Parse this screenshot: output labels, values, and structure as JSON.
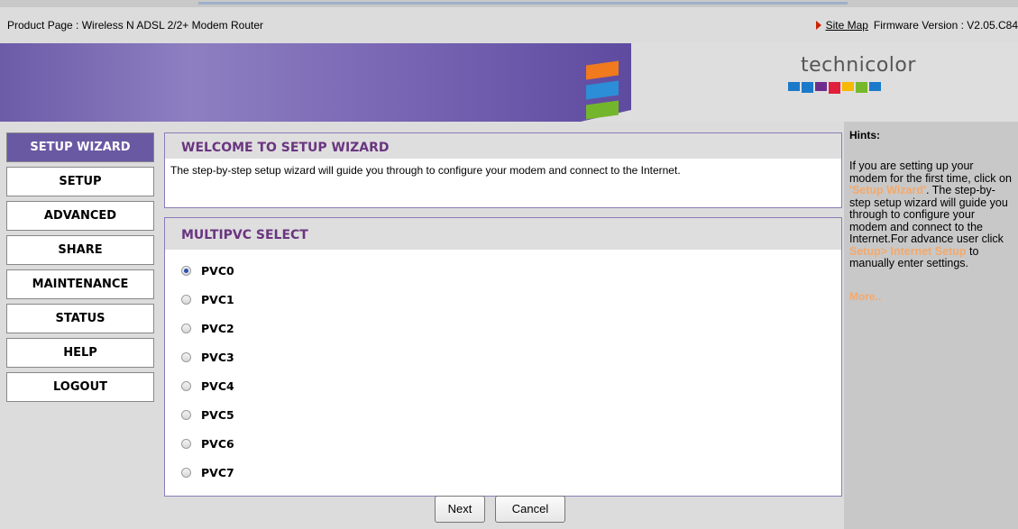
{
  "header": {
    "product_page": "Product Page : Wireless N ADSL 2/2+ Modem Router",
    "site_map": "Site Map",
    "firmware": "Firmware Version : V2.05.C84"
  },
  "banner": {
    "logo_text": "technicolor"
  },
  "sidebar": {
    "items": [
      {
        "label": "SETUP WIZARD",
        "active": true
      },
      {
        "label": "SETUP"
      },
      {
        "label": "ADVANCED"
      },
      {
        "label": "SHARE"
      },
      {
        "label": "MAINTENANCE"
      },
      {
        "label": "STATUS"
      },
      {
        "label": "HELP"
      },
      {
        "label": "LOGOUT"
      }
    ]
  },
  "welcome": {
    "title": "WELCOME TO SETUP WIZARD",
    "text": "The step-by-step setup wizard will guide you through to configure your modem and connect to the Internet."
  },
  "multipvc": {
    "title": "MULTIPVC SELECT",
    "options": [
      "PVC0",
      "PVC1",
      "PVC2",
      "PVC3",
      "PVC4",
      "PVC5",
      "PVC6",
      "PVC7"
    ],
    "selected": "PVC0"
  },
  "buttons": {
    "next": "Next",
    "cancel": "Cancel"
  },
  "hints": {
    "title": "Hints:",
    "part1": "If you are setting up your modem for the first time, click on ",
    "link1": "'Setup Wizard'",
    "part2": ". The step-by-step setup wizard will guide you through to configure your modem and connect to the Internet.For advance user click ",
    "link2": "Setup> Internet Setup",
    "part3": " to manually enter settings.",
    "more": "More.."
  },
  "colors": {
    "menu_active": "#6959a3",
    "title_text": "#6a3580",
    "hint_link": "#f3a96c"
  }
}
